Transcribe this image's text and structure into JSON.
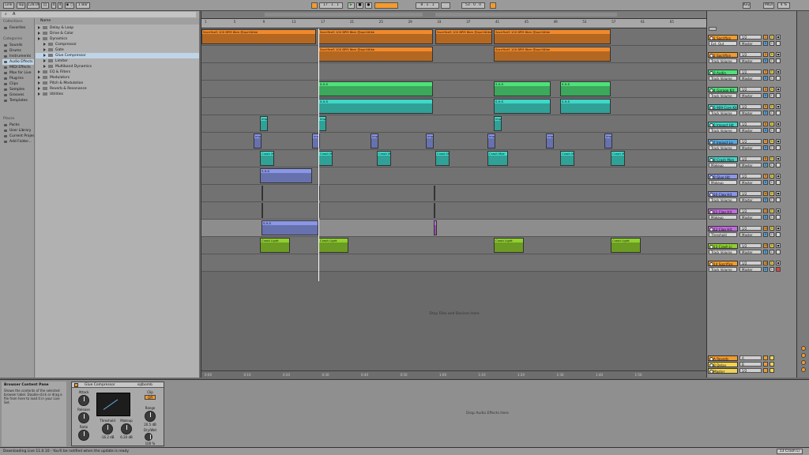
{
  "colors": {
    "accent": "#f39b2c",
    "orange_clip": "#f08a2c",
    "green_clip": "#4fe07a",
    "teal_clip": "#3fd7c8",
    "blue_clip": "#8a97e8",
    "lime_clip": "#8fcf2e",
    "violet": "#c46be0"
  },
  "topbar": {
    "link": "Link",
    "tap": "Tap",
    "tempo": "128.00",
    "tempo_mod": "|||",
    "sig_num": "4",
    "sig_den": "4",
    "metro": "◉ ○",
    "quant": "1 Bar",
    "pos": "17 . 1 . 1",
    "play": "▶",
    "stop": "■",
    "rec": "●",
    "loop_start": "8 . 1 . 1",
    "loop_len": "53 . 0 . 0",
    "key": "Key",
    "midi": "MIDI",
    "cpu": "4 %"
  },
  "browser": {
    "search_placeholder": "A",
    "sections": [
      "Collections",
      "Categories",
      "Places"
    ],
    "collections": [
      {
        "label": "Favorites"
      }
    ],
    "categories": [
      {
        "label": "Sounds"
      },
      {
        "label": "Drums"
      },
      {
        "label": "Instruments"
      },
      {
        "label": "Audio Effects"
      },
      {
        "label": "MIDI Effects"
      },
      {
        "label": "Max for Live"
      },
      {
        "label": "Plug-Ins"
      },
      {
        "label": "Clips"
      },
      {
        "label": "Samples"
      },
      {
        "label": "Grooves"
      },
      {
        "label": "Templates"
      }
    ],
    "places": [
      {
        "label": "Packs"
      },
      {
        "label": "User Library"
      },
      {
        "label": "Current Project"
      },
      {
        "label": "Add Folder..."
      }
    ],
    "name_header": "Name",
    "files": [
      {
        "label": "Delay & Loop",
        "level": 0,
        "type": "folder"
      },
      {
        "label": "Drive & Color",
        "level": 0,
        "type": "folder"
      },
      {
        "label": "Dynamics",
        "level": 0,
        "type": "folder"
      },
      {
        "label": "Compressor",
        "level": 1,
        "type": "folder"
      },
      {
        "label": "Gate",
        "level": 1,
        "type": "folder"
      },
      {
        "label": "Glue Compressor",
        "level": 1,
        "type": "folder"
      },
      {
        "label": "Limiter",
        "level": 1,
        "type": "folder"
      },
      {
        "label": "Multiband Dynamics",
        "level": 1,
        "type": "folder"
      },
      {
        "label": "EQ & Filters",
        "level": 0,
        "type": "folder"
      },
      {
        "label": "Modulators",
        "level": 0,
        "type": "folder"
      },
      {
        "label": "Pitch & Modulation",
        "level": 0,
        "type": "folder"
      },
      {
        "label": "Reverb & Resonance",
        "level": 0,
        "type": "folder"
      },
      {
        "label": "Utilities",
        "level": 0,
        "type": "folder"
      }
    ]
  },
  "arrangement": {
    "bars": [
      "1",
      "5",
      "9",
      "13",
      "17",
      "21",
      "25",
      "29",
      "33",
      "37",
      "41",
      "45",
      "49",
      "53",
      "57",
      "61",
      "65"
    ],
    "times": [
      "0:00",
      "0:10",
      "0:20",
      "0:30",
      "0:40",
      "0:50",
      "1:00",
      "1:10",
      "1:20",
      "1:30",
      "1:40",
      "1:50"
    ],
    "drop_hint": "Drop Files and Devices Here",
    "clip_label_sacrifice": "SacrificeS 100 BPM 8bm @april4tike",
    "clip_label_crash_light": "Crash Light",
    "clip_label_crash_ma": "Crash Ma",
    "clip_label_impact": "Imp",
    "clip_label_riser": "S-9-S",
    "clip_label_crash_mac": "Crash Mac"
  },
  "tracks": [
    {
      "name": "1 Sacrifice",
      "color": "#f39b2c",
      "routing": "Ext. Out",
      "target": "Master",
      "vol": "0",
      "active": "1"
    },
    {
      "name": "2 Sacrifice",
      "color": "#f39b2c",
      "routing": "Track Volume",
      "target": "Master",
      "vol": "0",
      "active": "2"
    },
    {
      "name": "3 Audio",
      "color": "#4fe07a",
      "routing": "Track Volume",
      "target": "Master",
      "vol": "0",
      "active": "3"
    },
    {
      "name": "4 Garage Kit",
      "color": "#4fe07a",
      "routing": "Track Volume",
      "target": "Master",
      "vol": "0",
      "active": "4"
    },
    {
      "name": "5 909 Core Kit",
      "color": "#3fd7c8",
      "routing": "Track Volume",
      "target": "Master",
      "vol": "0",
      "active": "5"
    },
    {
      "name": "6 Impact Hit",
      "color": "#3fd7c8",
      "routing": "Track Volume",
      "target": "Master",
      "vol": "0",
      "active": "6"
    },
    {
      "name": "7 Impact Lo",
      "color": "#5aa7e0",
      "routing": "Track Volume",
      "target": "Master",
      "vol": "0",
      "active": "7"
    },
    {
      "name": "8 Crash Mon",
      "color": "#3fd7c8",
      "routing": "Makeup",
      "target": "Master",
      "vol": "0",
      "active": "8"
    },
    {
      "name": "9 Glue Hit",
      "color": "#8a97e8",
      "routing": "Makeup",
      "target": "Master",
      "vol": "0",
      "active": "9"
    },
    {
      "name": "10 Clap Hit",
      "color": "#8a97e8",
      "routing": "Track Volume",
      "target": "Master",
      "vol": "0",
      "active": "10"
    },
    {
      "name": "11 Clap Hit",
      "color": "#c46be0",
      "routing": "Makeup",
      "target": "Master",
      "vol": "0",
      "active": "11"
    },
    {
      "name": "12 Clap Hit",
      "color": "#c46be0",
      "routing": "Threshold",
      "target": "Master",
      "vol": "0",
      "active": "12"
    },
    {
      "name": "13 Crash Li",
      "color": "#8fcf2e",
      "routing": "Track Volume",
      "target": "Master",
      "vol": "0",
      "active": "13"
    },
    {
      "name": "14 Sacrifice",
      "color": "#f39b2c",
      "routing": "Track Volume",
      "target": "Master",
      "vol": "0",
      "active": "14"
    }
  ],
  "returns": [
    {
      "name": "A Reverb",
      "color": "#f39b2c",
      "letter": "A"
    },
    {
      "name": "B Delay",
      "color": "#f2d34f",
      "letter": "B"
    },
    {
      "name": "Master",
      "color": "#f2d34f",
      "letter": "1/2"
    }
  ],
  "info": {
    "title": "Browser Content Pane",
    "text": "Shows the contents of the selected browser label. Double-click or drag a file from here to load it in your Live Set."
  },
  "device": {
    "name": "Glue Compressor",
    "preset": "sqlbomb",
    "attack_label": "Attack",
    "release_label": "Release",
    "ratio_label": "Ratio",
    "threshold_label": "Threshold",
    "makeup_label": "Makeup",
    "threshold_value": "-16.2 dB",
    "makeup_value": "6.20 dB",
    "clip_label": "Clip",
    "clip_state": "Off",
    "range_label": "Range",
    "range_value": "20.5 dB",
    "drywet_label": "Dry/Wet",
    "drywet_value": "100 %"
  },
  "drop_fx": "Drop Audio Effects Here",
  "status": {
    "message": "Downloading Live 11.0.10 - You'll be notified when the update is ready",
    "right": "13 Crash Li"
  }
}
